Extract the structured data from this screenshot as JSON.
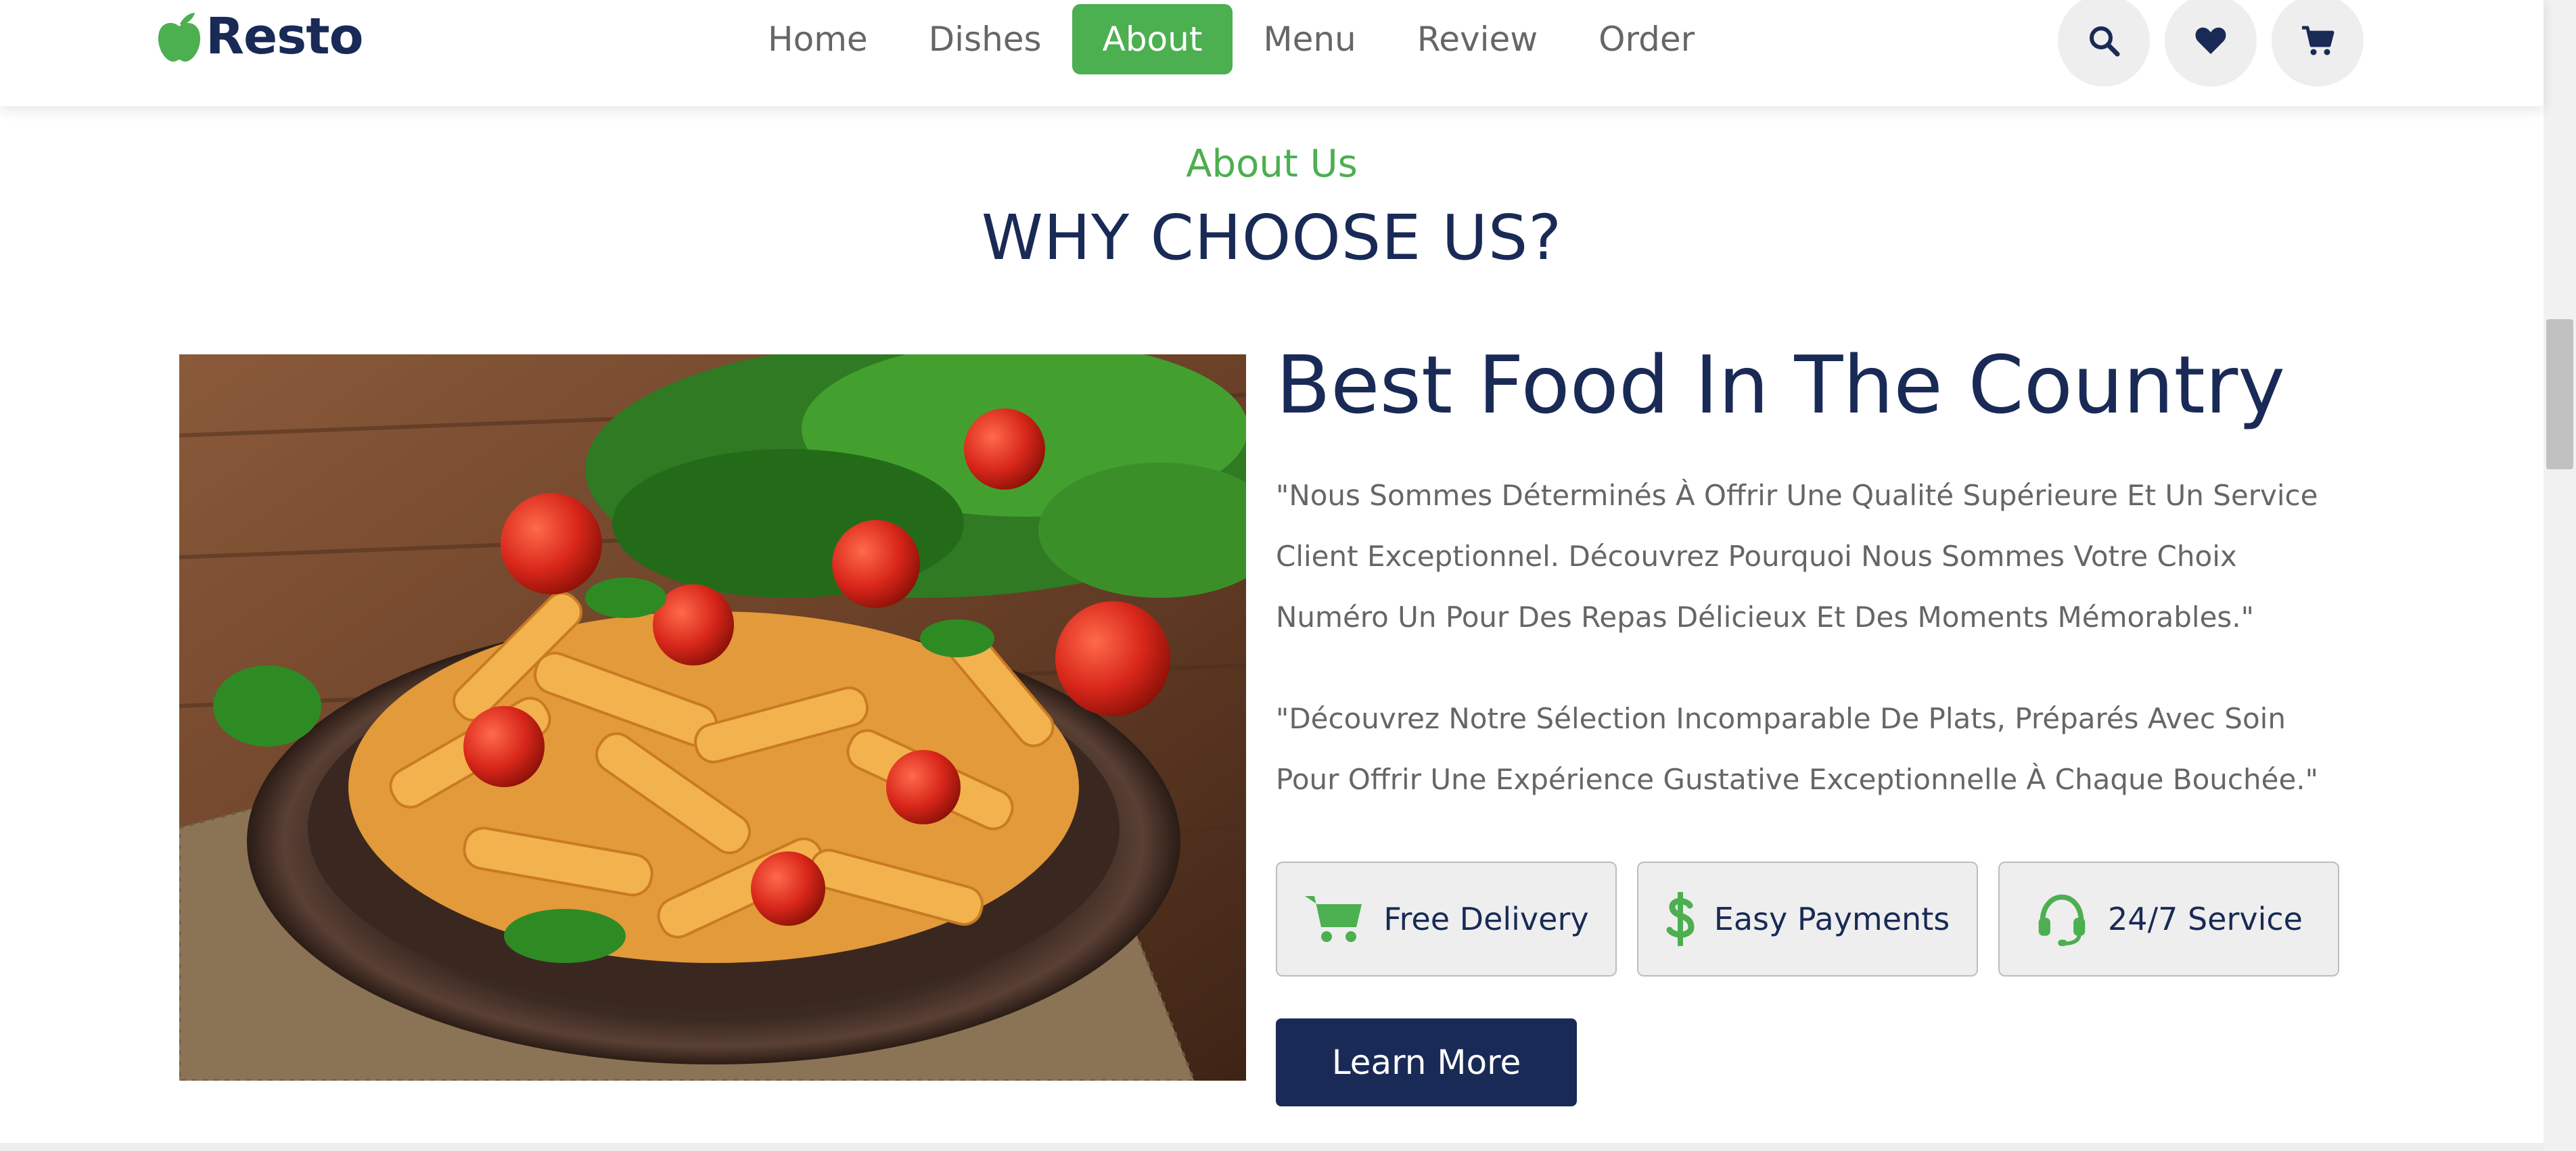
{
  "brand": {
    "name": "Resto",
    "logo_icon": "apple-icon",
    "accent": "#4caf50",
    "primary": "#192a56"
  },
  "nav": {
    "items": [
      {
        "label": "Home"
      },
      {
        "label": "Dishes"
      },
      {
        "label": "About"
      },
      {
        "label": "Menu"
      },
      {
        "label": "Review"
      },
      {
        "label": "Order"
      }
    ],
    "active": "About"
  },
  "header_icons": [
    "search-icon",
    "heart-icon",
    "cart-icon"
  ],
  "section": {
    "subheading": "About Us",
    "heading": "WHY CHOOSE US?"
  },
  "about": {
    "image_icon": "pasta-dish-image",
    "title": "Best Food In The Country",
    "paragraph1": "\"Nous Sommes Déterminés À Offrir Une Qualité Supérieure Et Un Service Client Exceptionnel. Découvrez Pourquoi Nous Sommes Votre Choix Numéro Un Pour Des Repas Délicieux Et Des Moments Mémorables.\"",
    "paragraph2": "\"Découvrez Notre Sélection Incomparable De Plats, Préparés Avec Soin Pour Offrir Une Expérience Gustative Exceptionnelle À Chaque Bouchée.\"",
    "features": [
      {
        "label": "Free Delivery",
        "icon": "shopping-cart-icon"
      },
      {
        "label": "Easy Payments",
        "icon": "dollar-icon"
      },
      {
        "label": "24/7 Service",
        "icon": "headset-icon"
      }
    ],
    "button_label": "Learn More"
  }
}
